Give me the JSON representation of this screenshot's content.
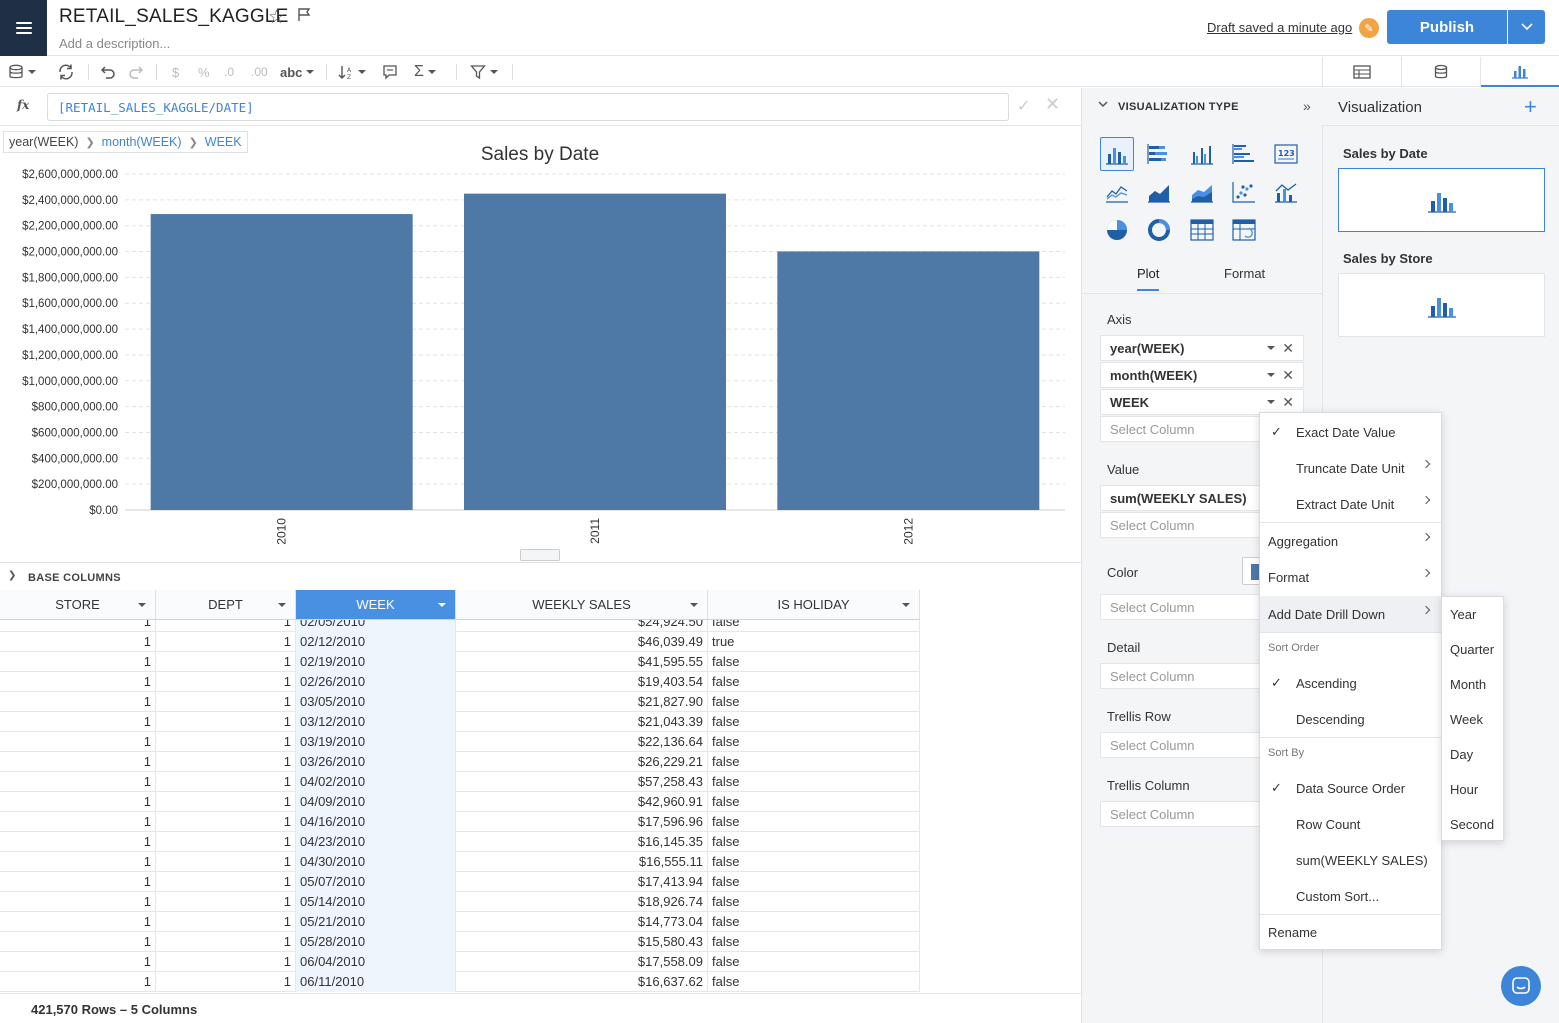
{
  "header": {
    "title": "RETAIL_SALES_KAGGLE",
    "description_placeholder": "Add a description...",
    "draft_status": "Draft saved a minute ago",
    "publish_label": "Publish"
  },
  "toolbar": {
    "currency_symbol": "$",
    "percent_symbol": "%",
    "decimal_less": ".0",
    "decimal_more": ".00",
    "text_format": "abc"
  },
  "formula": {
    "label": "fx",
    "value": "[RETAIL_SALES_KAGGLE/DATE]"
  },
  "breadcrumb": {
    "items": [
      "year(WEEK)",
      "month(WEEK)",
      "WEEK"
    ]
  },
  "chart_data": {
    "type": "bar",
    "title": "Sales by Date",
    "categories": [
      "2010",
      "2011",
      "2012"
    ],
    "values": [
      2290000000,
      2448000000,
      2001000000
    ],
    "ylim": [
      0,
      2600000000
    ],
    "yticks": [
      "$0.00",
      "$200,000,000.00",
      "$400,000,000.00",
      "$600,000,000.00",
      "$800,000,000.00",
      "$1,000,000,000.00",
      "$1,200,000,000.00",
      "$1,400,000,000.00",
      "$1,600,000,000.00",
      "$1,800,000,000.00",
      "$2,000,000,000.00",
      "$2,200,000,000.00",
      "$2,400,000,000.00",
      "$2,600,000,000.00"
    ],
    "bar_color": "#4e79a7",
    "grid": true,
    "xlabel": "",
    "ylabel": ""
  },
  "table": {
    "section_label": "BASE COLUMNS",
    "columns": [
      "STORE",
      "DEPT",
      "WEEK",
      "WEEKLY SALES",
      "IS HOLIDAY"
    ],
    "rows": [
      [
        "1",
        "1",
        "02/05/2010",
        "$24,924.50",
        "false"
      ],
      [
        "1",
        "1",
        "02/12/2010",
        "$46,039.49",
        "true"
      ],
      [
        "1",
        "1",
        "02/19/2010",
        "$41,595.55",
        "false"
      ],
      [
        "1",
        "1",
        "02/26/2010",
        "$19,403.54",
        "false"
      ],
      [
        "1",
        "1",
        "03/05/2010",
        "$21,827.90",
        "false"
      ],
      [
        "1",
        "1",
        "03/12/2010",
        "$21,043.39",
        "false"
      ],
      [
        "1",
        "1",
        "03/19/2010",
        "$22,136.64",
        "false"
      ],
      [
        "1",
        "1",
        "03/26/2010",
        "$26,229.21",
        "false"
      ],
      [
        "1",
        "1",
        "04/02/2010",
        "$57,258.43",
        "false"
      ],
      [
        "1",
        "1",
        "04/09/2010",
        "$42,960.91",
        "false"
      ],
      [
        "1",
        "1",
        "04/16/2010",
        "$17,596.96",
        "false"
      ],
      [
        "1",
        "1",
        "04/23/2010",
        "$16,145.35",
        "false"
      ],
      [
        "1",
        "1",
        "04/30/2010",
        "$16,555.11",
        "false"
      ],
      [
        "1",
        "1",
        "05/07/2010",
        "$17,413.94",
        "false"
      ],
      [
        "1",
        "1",
        "05/14/2010",
        "$18,926.74",
        "false"
      ],
      [
        "1",
        "1",
        "05/21/2010",
        "$14,773.04",
        "false"
      ],
      [
        "1",
        "1",
        "05/28/2010",
        "$15,580.43",
        "false"
      ],
      [
        "1",
        "1",
        "06/04/2010",
        "$17,558.09",
        "false"
      ],
      [
        "1",
        "1",
        "06/11/2010",
        "$16,637.62",
        "false"
      ]
    ],
    "row_count": "421,570 Rows – 5 Columns"
  },
  "viz_panel": {
    "heading": "VISUALIZATION TYPE",
    "tabs": [
      "Plot",
      "Format"
    ],
    "axis_label": "Axis",
    "axis_fields": [
      "year(WEEK)",
      "month(WEEK)",
      "WEEK"
    ],
    "value_label": "Value",
    "value_fields": [
      "sum(WEEKLY SALES)"
    ],
    "color_label": "Color",
    "detail_label": "Detail",
    "trellis_row_label": "Trellis Row",
    "trellis_column_label": "Trellis Column",
    "select_placeholder": "Select Column"
  },
  "viz_list": {
    "title": "Visualization",
    "add_label": "+",
    "items": [
      "Sales by Date",
      "Sales by Store"
    ]
  },
  "context_menu": {
    "exact_date": "Exact Date Value",
    "truncate": "Truncate Date Unit",
    "extract": "Extract Date Unit",
    "aggregation": "Aggregation",
    "format": "Format",
    "drill_down": "Add Date Drill Down",
    "sort_order_head": "Sort Order",
    "ascending": "Ascending",
    "descending": "Descending",
    "sort_by_head": "Sort By",
    "data_source_order": "Data Source Order",
    "row_count": "Row Count",
    "sum_sales": "sum(WEEKLY SALES)",
    "custom_sort": "Custom Sort...",
    "rename": "Rename"
  },
  "sub_menu": {
    "items": [
      "Year",
      "Quarter",
      "Month",
      "Week",
      "Day",
      "Hour",
      "Second"
    ]
  }
}
